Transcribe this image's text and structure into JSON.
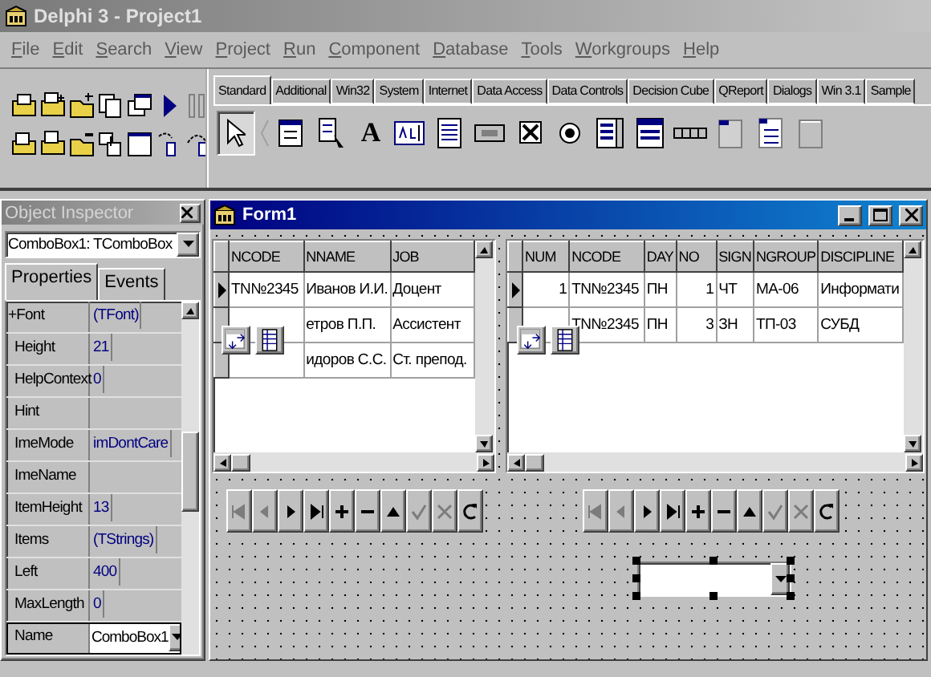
{
  "app_window": {
    "title": "Delphi 3 - Project1"
  },
  "menu": [
    "File",
    "Edit",
    "Search",
    "View",
    "Project",
    "Run",
    "Component",
    "Database",
    "Tools",
    "Workgroups",
    "Help"
  ],
  "palette": {
    "tabs": [
      {
        "label": "Standard",
        "selected": true
      },
      {
        "label": "Additional",
        "selected": false
      },
      {
        "label": "Win32",
        "selected": false
      },
      {
        "label": "System",
        "selected": false
      },
      {
        "label": "Internet",
        "selected": false
      },
      {
        "label": "Data Access",
        "selected": false
      },
      {
        "label": "Data Controls",
        "selected": false
      },
      {
        "label": "Decision Cube",
        "selected": false
      },
      {
        "label": "QReport",
        "selected": false
      },
      {
        "label": "Dialogs",
        "selected": false
      },
      {
        "label": "Win 3.1",
        "selected": false
      },
      {
        "label": "Sample",
        "selected": false
      }
    ],
    "label_glyph": "A"
  },
  "object_inspector": {
    "title": "Object Inspector",
    "component": "ComboBox1: TComboBox",
    "tabs": [
      {
        "label": "Properties",
        "selected": true
      },
      {
        "label": "Events",
        "selected": false
      }
    ],
    "properties": [
      {
        "kind": "group",
        "name": "+Font",
        "value": "(TFont)",
        "selected": false
      },
      {
        "kind": "plain",
        "name": "Height",
        "value": "21",
        "selected": false
      },
      {
        "kind": "plain",
        "name": "HelpContext",
        "value": "0",
        "selected": false
      },
      {
        "kind": "plain",
        "name": "Hint",
        "selected": false
      },
      {
        "kind": "plain",
        "name": "ImeMode",
        "value": "imDontCare",
        "selected": false
      },
      {
        "kind": "plain",
        "name": "ImeName",
        "selected": false
      },
      {
        "kind": "plain",
        "name": "ItemHeight",
        "value": "13",
        "selected": false
      },
      {
        "kind": "plain",
        "name": "Items",
        "value": "(TStrings)",
        "selected": false
      },
      {
        "kind": "plain",
        "name": "Left",
        "value": "400",
        "selected": false
      },
      {
        "kind": "plain",
        "name": "MaxLength",
        "value": "0",
        "selected": false
      },
      {
        "kind": "plain",
        "name": "Name",
        "value": "ComboBox1",
        "selected": true
      }
    ]
  },
  "form": {
    "title": "Form1",
    "grids": [
      {
        "columns": [
          {
            "label": "NCODE",
            "numeric": false
          },
          {
            "label": "NNAME",
            "numeric": false
          },
          {
            "label": "JOB",
            "numeric": false
          }
        ],
        "rows": [
          {
            "current": true,
            "cells": [
              "TN№2345",
              "Иванов И.И.",
              "Доцент"
            ]
          },
          {
            "current": false,
            "cells": [
              null,
              "етров П.П.",
              "Ассистент"
            ]
          },
          {
            "current": false,
            "cells": [
              null,
              "идоров С.С.",
              "Ст. препод."
            ]
          }
        ]
      },
      {
        "columns": [
          {
            "label": "NUM",
            "numeric": true
          },
          {
            "label": "NCODE",
            "numeric": false
          },
          {
            "label": "DAY",
            "numeric": false
          },
          {
            "label": "NO",
            "numeric": true
          },
          {
            "label": "SIGN",
            "numeric": false
          },
          {
            "label": "NGROUP",
            "numeric": false
          },
          {
            "label": "DISCIPLINE",
            "numeric": false
          }
        ],
        "rows": [
          {
            "current": true,
            "cells": [
              "1",
              "TN№2345",
              "ПН",
              "1",
              "ЧТ",
              "МА-06",
              "Информати"
            ]
          },
          {
            "current": false,
            "cells": [
              null,
              "TN№2345",
              "ПН",
              "3",
              "ЗН",
              "ТП-03",
              "СУБД"
            ]
          }
        ]
      }
    ],
    "navigators": [
      {
        "buttons": [
          {
            "kind": "first",
            "disabled": true
          },
          {
            "kind": "prior",
            "disabled": true
          },
          {
            "kind": "next",
            "disabled": false
          },
          {
            "kind": "last",
            "disabled": false
          },
          {
            "kind": "insert",
            "disabled": false
          },
          {
            "kind": "delete",
            "disabled": false
          },
          {
            "kind": "edit",
            "disabled": false
          },
          {
            "kind": "post",
            "disabled": true
          },
          {
            "kind": "cancel",
            "disabled": true
          },
          {
            "kind": "refresh",
            "disabled": false
          }
        ]
      },
      {
        "buttons": [
          {
            "kind": "first",
            "disabled": true
          },
          {
            "kind": "prior",
            "disabled": true
          },
          {
            "kind": "next",
            "disabled": false
          },
          {
            "kind": "last",
            "disabled": false
          },
          {
            "kind": "insert",
            "disabled": false
          },
          {
            "kind": "delete",
            "disabled": false
          },
          {
            "kind": "edit",
            "disabled": false
          },
          {
            "kind": "post",
            "disabled": true
          },
          {
            "kind": "cancel",
            "disabled": true
          },
          {
            "kind": "refresh",
            "disabled": false
          }
        ]
      }
    ],
    "combobox": {
      "selected": true
    }
  }
}
